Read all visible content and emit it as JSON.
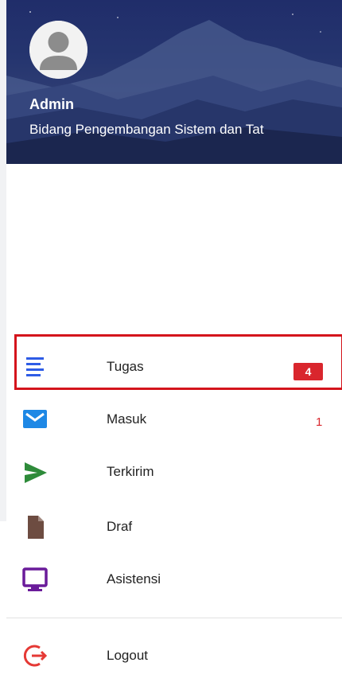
{
  "user": {
    "name": "Admin",
    "department": "Bidang Pengembangan Sistem dan Tat"
  },
  "menu": {
    "items": [
      {
        "label": "Tugas",
        "icon": "list-lines-icon",
        "badge": "4",
        "color": "#2e5ce6"
      },
      {
        "label": "Masuk",
        "icon": "envelope-icon",
        "badge": "1",
        "color": "#1e88e5"
      },
      {
        "label": "Terkirim",
        "icon": "send-arrow-icon",
        "color": "#2e8b3a"
      },
      {
        "label": "Draf",
        "icon": "document-icon",
        "color": "#6d4c41",
        "highlighted": true
      },
      {
        "label": "Asistensi",
        "icon": "monitor-icon",
        "color": "#6a1b9a"
      }
    ],
    "logout": {
      "label": "Logout",
      "icon": "logout-icon",
      "color": "#e53935"
    }
  },
  "colors": {
    "badge_red": "#d9262d",
    "highlight_border": "#d4141c",
    "header_bg": "#25356f"
  }
}
